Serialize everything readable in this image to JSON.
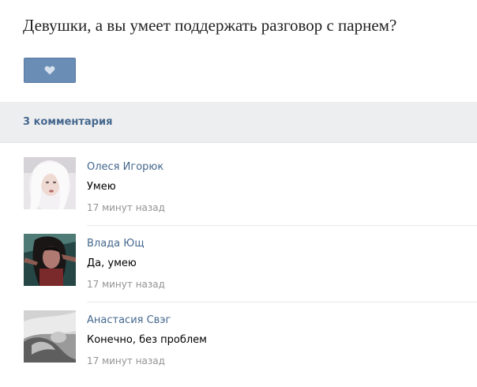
{
  "post": {
    "title": "Девушки, а вы умеет поддержать разговор с парнем?",
    "like_icon": "heart-icon"
  },
  "comments_section": {
    "count_label": "3 комментария"
  },
  "comments": [
    {
      "author": "Олеся Игорюк",
      "text": "Умею",
      "time": "17 минут назад"
    },
    {
      "author": "Влада Ющ",
      "text": "Да, умею",
      "time": "17 минут назад"
    },
    {
      "author": "Анастасия Свэг",
      "text": "Конечно, без проблем",
      "time": "17 минут назад"
    }
  ],
  "colors": {
    "accent": "#6a8db5",
    "link": "#45688e",
    "muted": "#939393"
  }
}
